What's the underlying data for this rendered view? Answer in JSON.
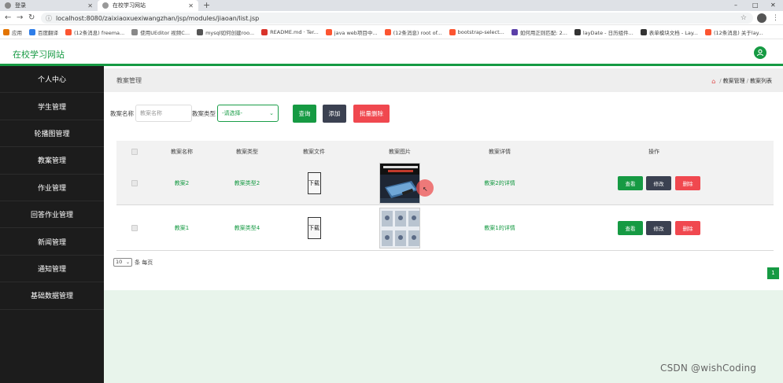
{
  "browser": {
    "tabs": [
      {
        "label": "登录",
        "active": false
      },
      {
        "label": "在校学习网站",
        "active": true
      }
    ],
    "new_tab": "+",
    "url": "localhost:8080/zaixiaoxuexiwangzhan/jsp/modules/jiaoan/list.jsp",
    "window_controls": {
      "minimize": "–",
      "maximize": "□",
      "close": "✕"
    },
    "bookmarks": [
      {
        "label": "应用",
        "color": "#e37400"
      },
      {
        "label": "百度翻译",
        "color": "#2e7de8"
      },
      {
        "label": "(12条消息) freema...",
        "color": "#fc5531"
      },
      {
        "label": "使用UEditor 视频C...",
        "color": "#888888"
      },
      {
        "label": "mysql如何创建roo...",
        "color": "#555555"
      },
      {
        "label": "README.md · Ter...",
        "color": "#d9342b"
      },
      {
        "label": "java web项目中...",
        "color": "#fc5531"
      },
      {
        "label": "(12条消息) root of...",
        "color": "#fc5531"
      },
      {
        "label": "bootstrap-select...",
        "color": "#fc5531"
      },
      {
        "label": "如何用正则匹配: 2...",
        "color": "#5b3fa8"
      },
      {
        "label": "layDate - 日历组件...",
        "color": "#333333"
      },
      {
        "label": "表单模块文档 - Lay...",
        "color": "#333333"
      },
      {
        "label": "(12条消息) 关于lay...",
        "color": "#fc5531"
      }
    ]
  },
  "header": {
    "site_title": "在校学习网站",
    "accent": "#169a43"
  },
  "sidebar": {
    "items": [
      {
        "label": "个人中心"
      },
      {
        "label": "学生管理"
      },
      {
        "label": "轮播图管理"
      },
      {
        "label": "教案管理"
      },
      {
        "label": "作业管理"
      },
      {
        "label": "回答作业管理"
      },
      {
        "label": "新闻管理"
      },
      {
        "label": "通知管理"
      },
      {
        "label": "基础数据管理"
      }
    ]
  },
  "breadcrumb": {
    "title": "教案管理",
    "trail": [
      "教案管理",
      "教案列表"
    ],
    "separator": "/"
  },
  "filters": {
    "name_label": "教案名称",
    "name_placeholder": "教案名称",
    "type_label": "教案类型",
    "type_selected": "-请选择-",
    "search_button": "查询",
    "add_button": "添加",
    "batch_delete_button": "批量删除"
  },
  "table": {
    "columns": [
      "教案名称",
      "教案类型",
      "教案文件",
      "教案图片",
      "教案详情",
      "操作"
    ],
    "rows": [
      {
        "name": "教案2",
        "type": "教案类型2",
        "file_button": "下载",
        "detail": "教案2的详情"
      },
      {
        "name": "教案1",
        "type": "教案类型4",
        "file_button": "下载",
        "detail": "教案1的详情"
      }
    ],
    "actions": {
      "view": "查看",
      "edit": "修改",
      "delete": "删除"
    }
  },
  "pagination": {
    "page_size": "10",
    "page_size_suffix": "条 每页",
    "current_page": "1"
  },
  "watermark": "CSDN @wishCoding"
}
